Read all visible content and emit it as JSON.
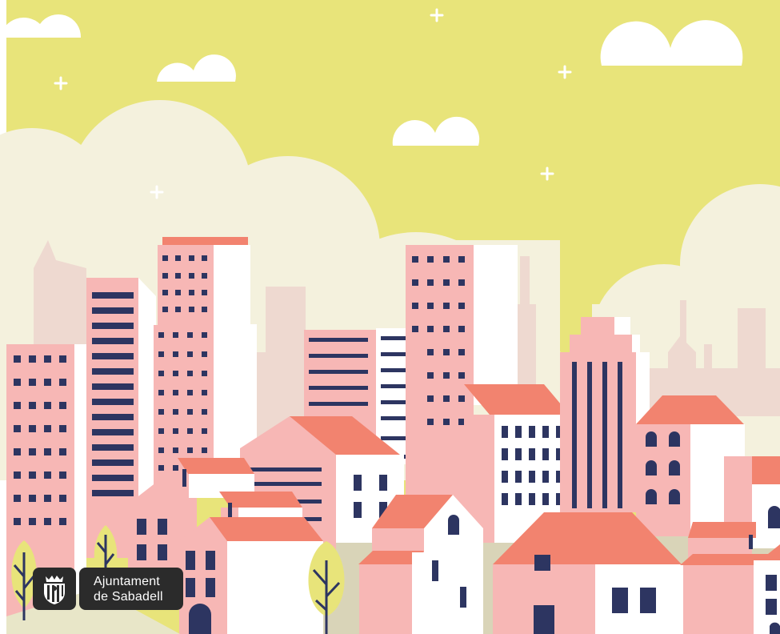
{
  "image": {
    "description_tags": [
      "flat city illustration",
      "pink buildings",
      "yellow sky",
      "clouds",
      "trees"
    ],
    "colors": {
      "sky": "#e8e47a",
      "cloud_back": "#f4f1dd",
      "cloud_white": "#ffffff",
      "building_pink": "#f7b7b5",
      "building_back": "#eed9d0",
      "roof_coral": "#f2836f",
      "window_navy": "#2d3561",
      "tree_yellow": "#e8e47a",
      "tree_trunk": "#2d3561",
      "ground": "#d9d4b8"
    }
  },
  "logo": {
    "line1": "Ajuntament",
    "line2": "de Sabadell",
    "emblem": "coat-of-arms-icon"
  }
}
